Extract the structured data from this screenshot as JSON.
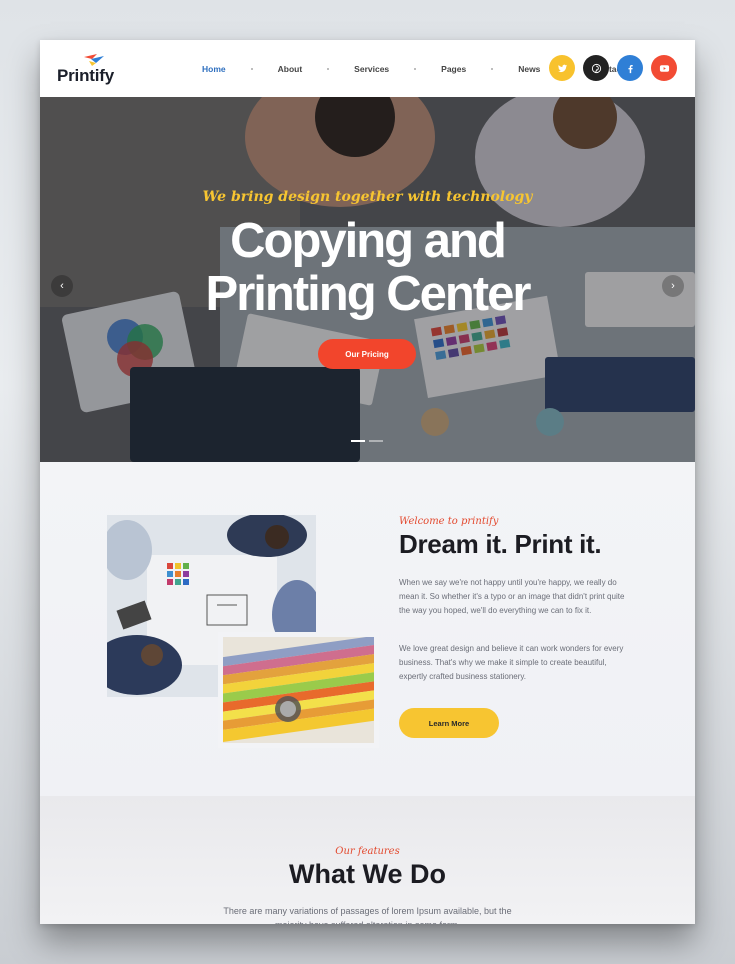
{
  "brand": {
    "name": "Printify"
  },
  "nav": {
    "items": [
      "Home",
      "About",
      "Services",
      "Pages",
      "News",
      "Contact"
    ],
    "active": "Home"
  },
  "socials": [
    {
      "icon": "twitter-icon",
      "color": "#f8c22d"
    },
    {
      "icon": "pinterest-icon",
      "color": "#222222"
    },
    {
      "icon": "facebook-icon",
      "color": "#2f7fd6"
    },
    {
      "icon": "youtube-icon",
      "color": "#f24b34"
    }
  ],
  "hero": {
    "script": "We bring design together with technology",
    "title_line1": "Copying and",
    "title_line2": "Printing Center",
    "button": "Our Pricing",
    "slides": 2,
    "active_slide": 1
  },
  "about": {
    "script": "Welcome to printify",
    "title": "Dream it. Print it.",
    "p1": "When we say we're not happy until you're happy, we really do mean it. So whether it's a typo or an image that didn't print quite the way you hoped, we'll do everything we can to fix it.",
    "p2": "We love great design and believe it can work wonders for every business. That's why we make it simple to create beautiful, expertly crafted business stationery.",
    "button": "Learn More"
  },
  "features": {
    "script": "Our features",
    "title": "What We Do",
    "text": "There are many variations of passages of lorem Ipsum available, but the majority have suffered alteration in some form."
  },
  "colors": {
    "accent_red": "#f2452c",
    "accent_yellow": "#f7c531",
    "nav_active": "#2e6fbf"
  }
}
